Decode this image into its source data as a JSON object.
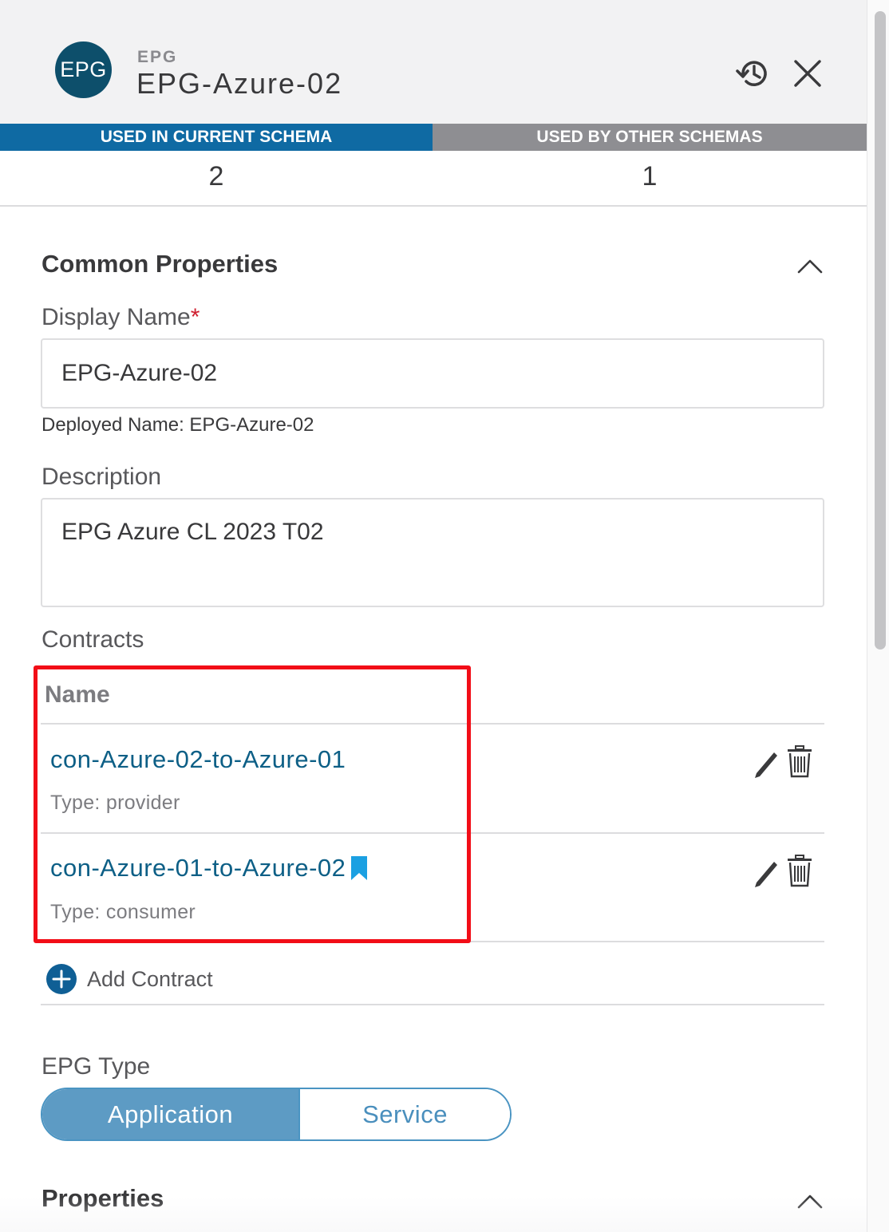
{
  "header": {
    "avatar_text": "EPG",
    "kicker": "EPG",
    "title": "EPG-Azure-02",
    "icons": [
      "history-icon",
      "close-icon"
    ]
  },
  "usage": {
    "current_label": "USED IN CURRENT SCHEMA",
    "current_count": "2",
    "other_label": "USED BY OTHER SCHEMAS",
    "other_count": "1"
  },
  "common": {
    "title": "Common Properties",
    "display_name_label": "Display Name",
    "required_mark": "*",
    "display_name_value": "EPG-Azure-02",
    "deployed_name": "Deployed Name: EPG-Azure-02",
    "description_label": "Description",
    "description_value": "EPG Azure CL 2023 T02",
    "contracts_label": "Contracts",
    "contracts_header": "Name",
    "contracts": [
      {
        "name": "con-Azure-02-to-Azure-01",
        "type": "Type: provider"
      },
      {
        "name": "con-Azure-01-to-Azure-02",
        "type": "Type: consumer"
      }
    ],
    "add_contract_label": "Add Contract",
    "epg_type_label": "EPG Type",
    "epg_type_options": [
      "Application",
      "Service"
    ],
    "epg_type_selected": "Application"
  },
  "properties": {
    "title": "Properties"
  },
  "colors": {
    "accent": "#0f6aa3",
    "link": "#0d5f86",
    "highlight": "#f20d17",
    "bookmark": "#1ba0e2"
  }
}
